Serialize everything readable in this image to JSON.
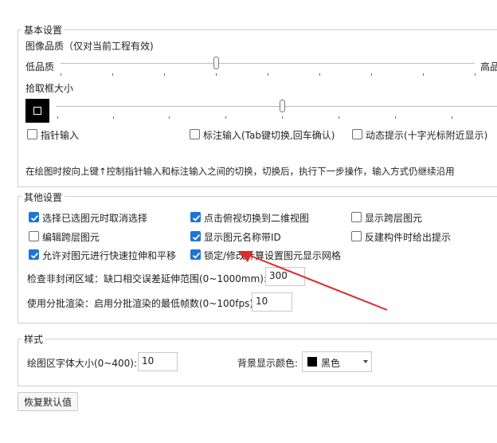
{
  "basic": {
    "legend": "基本设置",
    "image_quality_title": "图像品质（仅对当前工程有效)",
    "low_label": "低品质",
    "high_label": "高品",
    "image_quality_level": 0.4,
    "pickbox_title": "拾取框大小",
    "pickbox_level": 0.5,
    "pointer_input": {
      "label": "指针输入",
      "checked": false
    },
    "dimension_input": {
      "label": "标注输入(Tab键切换,回车确认)",
      "checked": false
    },
    "dynamic_prompt": {
      "label": "动态提示(十字光标附近显示)",
      "checked": false
    },
    "hint": "在绘图时按向上键↑控制指针输入和标注输入之间的切换，切换后，执行下一步操作，输入方式仍继续沿用"
  },
  "other": {
    "legend": "其他设置",
    "options": [
      {
        "label": "选择已选图元时取消选择",
        "checked": true
      },
      {
        "label": "点击俯视切换到二维视图",
        "checked": true
      },
      {
        "label": "显示跨层图元",
        "checked": false
      },
      {
        "label": "编辑跨层图元",
        "checked": false
      },
      {
        "label": "显示图元名称带ID",
        "checked": true
      },
      {
        "label": "反建构件时给出提示",
        "checked": false
      },
      {
        "label": "允许对图元进行快速拉伸和平移",
        "checked": true
      },
      {
        "label": "锁定/修改计算设置图元显示网格",
        "checked": true
      }
    ],
    "nonclosed_label": "检查非封闭区域：缺口相交误差延伸范围(0~1000mm):",
    "nonclosed_value": "300",
    "batch_label": "使用分批渲染：启用分批渲染的最低帧数(0~100fps):",
    "batch_value": "10"
  },
  "style": {
    "legend": "样式",
    "font_size_label": "绘图区字体大小(0~400):",
    "font_size_value": "10",
    "bg_color_label": "背景显示颜色:",
    "bg_color_value": "黑色",
    "bg_color_swatch": "#000000"
  },
  "restore_button": "恢复默认值",
  "colors": {
    "checkbox_checked": "#1e74d6",
    "annotation_arrow": "#e02b2b"
  }
}
